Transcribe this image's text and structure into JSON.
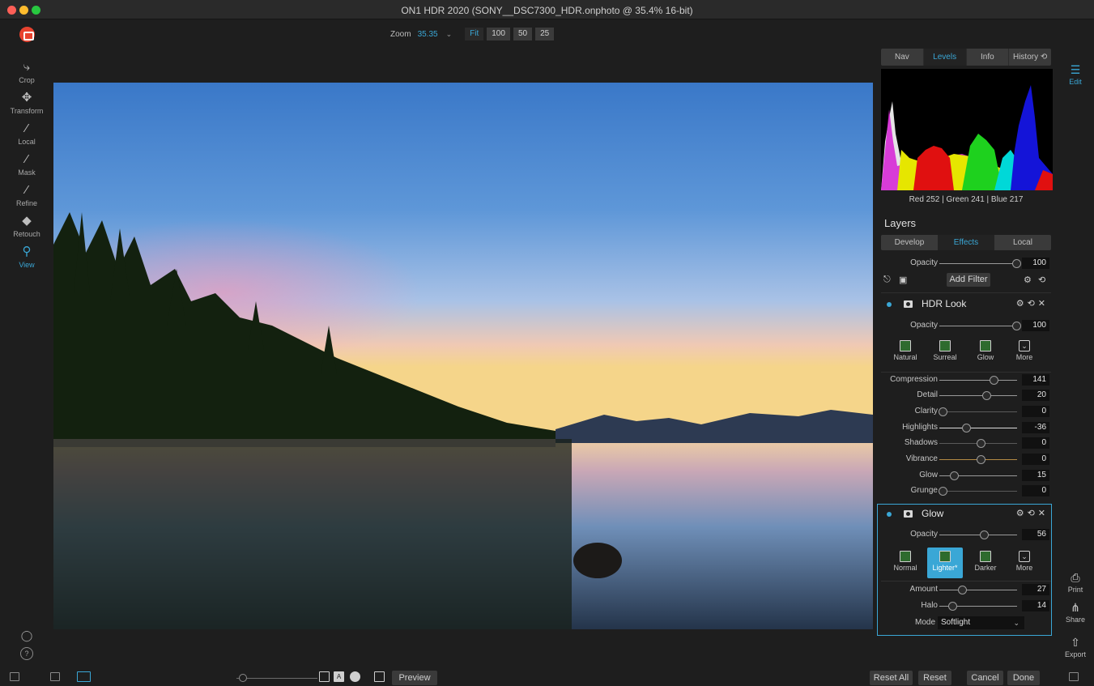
{
  "window": {
    "title": "ON1 HDR 2020 (SONY__DSC7300_HDR.onphoto @ 35.4% 16-bit)"
  },
  "zoom": {
    "label": "Zoom",
    "value": "35.35",
    "buttons": [
      "Fit",
      "100",
      "50",
      "25"
    ]
  },
  "left_tools": [
    {
      "name": "crop",
      "label": "Crop",
      "icon": "crop-icon"
    },
    {
      "name": "transform",
      "label": "Transform",
      "icon": "transform-icon"
    },
    {
      "name": "local",
      "label": "Local",
      "icon": "local-brush-icon"
    },
    {
      "name": "mask",
      "label": "Mask",
      "icon": "mask-brush-icon"
    },
    {
      "name": "refine",
      "label": "Refine",
      "icon": "refine-brush-icon"
    },
    {
      "name": "retouch",
      "label": "Retouch",
      "icon": "retouch-icon"
    },
    {
      "name": "view",
      "label": "View",
      "icon": "view-zoom-icon",
      "active": true
    }
  ],
  "panel": {
    "tabs": [
      "Nav",
      "Levels",
      "Info",
      "History ⟲"
    ],
    "active_tab": "Levels",
    "rgb_readout": "Red 252 | Green 241 | Blue 217",
    "layers_title": "Layers",
    "layer_tabs": [
      "Develop",
      "Effects",
      "Local"
    ],
    "active_layer_tab": "Effects",
    "master": {
      "opacity_label": "Opacity",
      "opacity_value": "100",
      "add_filter": "Add Filter"
    },
    "hdr_look": {
      "name": "HDR Look",
      "opacity_label": "Opacity",
      "opacity_value": "100",
      "presets": [
        "Natural",
        "Surreal",
        "Glow",
        "More"
      ],
      "sliders": [
        {
          "label": "Compression",
          "value": "141"
        },
        {
          "label": "Detail",
          "value": "20"
        },
        {
          "label": "Clarity",
          "value": "0"
        },
        {
          "label": "Highlights",
          "value": "-36"
        },
        {
          "label": "Shadows",
          "value": "0"
        },
        {
          "label": "Vibrance",
          "value": "0"
        },
        {
          "label": "Glow",
          "value": "15"
        },
        {
          "label": "Grunge",
          "value": "0"
        }
      ]
    },
    "glow": {
      "name": "Glow",
      "opacity_label": "Opacity",
      "opacity_value": "56",
      "presets": [
        "Normal",
        "Lighter*",
        "Darker",
        "More"
      ],
      "selected_preset": "Lighter*",
      "sliders": [
        {
          "label": "Amount",
          "value": "27"
        },
        {
          "label": "Halo",
          "value": "14"
        }
      ],
      "mode_label": "Mode",
      "mode_value": "Softlight"
    }
  },
  "right_tools": [
    {
      "label": "Edit",
      "icon": "edit-sliders-icon",
      "active": true
    },
    {
      "label": "Print",
      "icon": "printer-icon"
    },
    {
      "label": "Share",
      "icon": "share-icon"
    },
    {
      "label": "Export",
      "icon": "export-icon"
    }
  ],
  "bottom": {
    "preview": "Preview",
    "reset_all": "Reset All",
    "reset": "Reset",
    "cancel": "Cancel",
    "done": "Done"
  },
  "colors": {
    "accent": "#3aa7d6",
    "background": "#1e1e1e"
  }
}
